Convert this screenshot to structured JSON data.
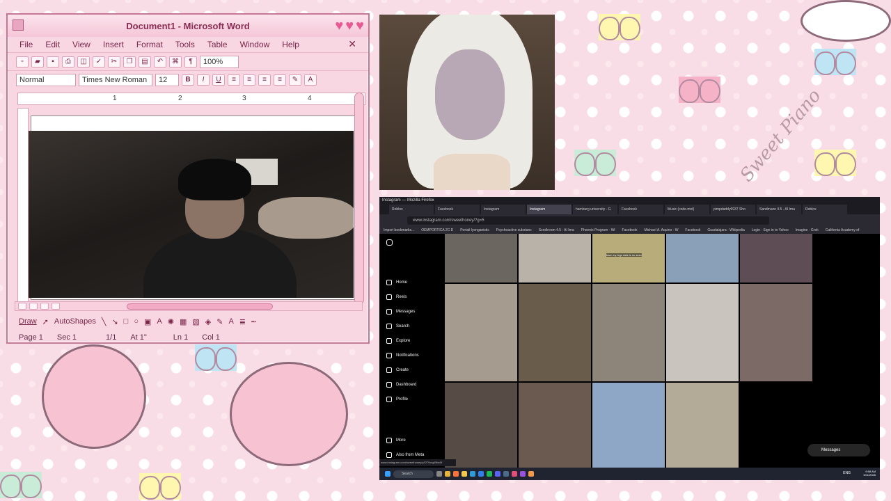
{
  "word": {
    "title": "Document1 - Microsoft Word",
    "menu": [
      "File",
      "Edit",
      "View",
      "Insert",
      "Format",
      "Tools",
      "Table",
      "Window",
      "Help"
    ],
    "zoom": "100%",
    "style": "Normal",
    "font": "Times New Roman",
    "size": "12",
    "ruler_marks": [
      "1",
      "2",
      "3",
      "4"
    ],
    "draw_label": "Draw",
    "autoshapes_label": "AutoShapes",
    "status": {
      "page": "Page 1",
      "sec": "Sec 1",
      "count": "1/1",
      "at": "At 1\"",
      "ln": "Ln 1",
      "col": "Col 1"
    },
    "accent_color": "#e55a93"
  },
  "wallpaper": {
    "watermark": "Sweet Piano"
  },
  "firefox": {
    "title": "Instagram — Mozilla Firefox",
    "tabs": [
      "Roblox",
      "Facebook",
      "Instagram",
      "Instagram",
      "hamburg university - G",
      "Facebook",
      "Music (code.mnt)",
      "pimpdaddy6937 Sho",
      "Sandmaze 4.5 - AI Ima",
      "Roblox"
    ],
    "url": "www.instagram.com/sweethoney/?g=5",
    "bookmarks": [
      "Import bookmarks...",
      "OEMPORTICA 2C D",
      "Portail lyonganistic",
      "Psychoactive substanc",
      "Scrollroom 4.5 - AI Ima",
      "Phoenix Program - Wi",
      "Facebook",
      "Michael A. Aquino - W",
      "Facebook",
      "Guadalajara - Wikipedia",
      "Login · Sign in to Yahoo",
      "Imagine · Grok",
      "California Academy of"
    ],
    "status_link": "www.instagram.com/sweethoney/p/DT9xxg5fhw5f",
    "nav": [
      "Home",
      "Reels",
      "Messages",
      "Search",
      "Explore",
      "Notifications",
      "Create",
      "Dashboard",
      "Profile"
    ],
    "more": "More",
    "also_from_meta": "Also from Meta",
    "messages_button": "Messages",
    "photo_caption": "bare my legs date is no seen",
    "taskbar_search": "Search",
    "clock_time": "9:58 AM",
    "clock_date": "5/11/2026",
    "tray_lang": "ENG"
  }
}
